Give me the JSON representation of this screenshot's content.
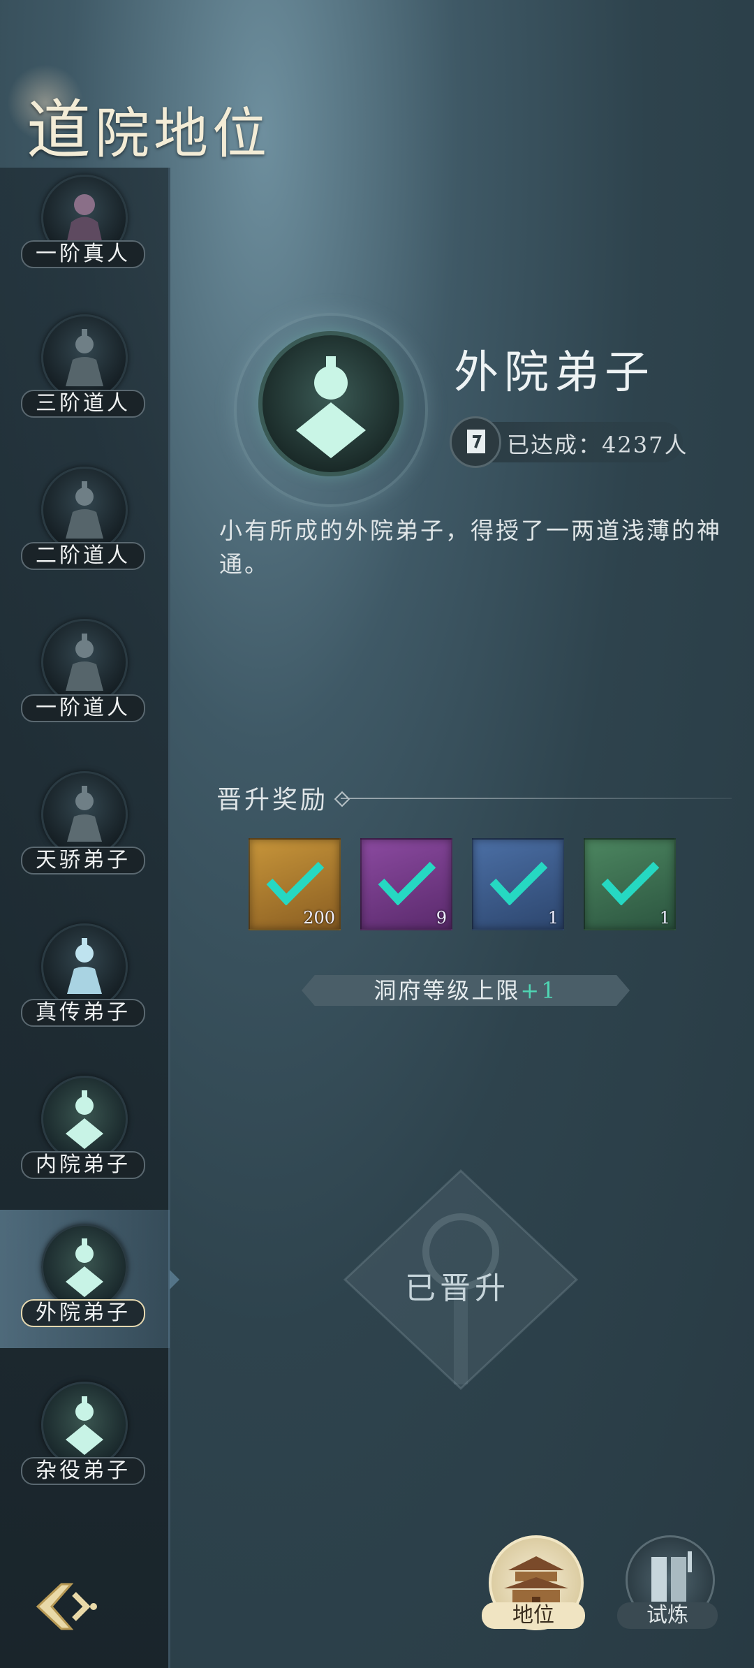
{
  "title": {
    "first_char": "道",
    "rest": "院地位"
  },
  "sidebar": {
    "items": [
      {
        "label": "一阶真人",
        "icon": "true-person-avatar-icon"
      },
      {
        "label": "三阶道人",
        "icon": "daoist-avatar-icon"
      },
      {
        "label": "二阶道人",
        "icon": "daoist-avatar-icon"
      },
      {
        "label": "一阶道人",
        "icon": "daoist-avatar-icon"
      },
      {
        "label": "天骄弟子",
        "icon": "disciple-avatar-icon"
      },
      {
        "label": "真传弟子",
        "icon": "disciple-avatar-icon"
      },
      {
        "label": "内院弟子",
        "icon": "disciple-avatar-icon"
      },
      {
        "label": "外院弟子",
        "icon": "disciple-avatar-icon",
        "selected": true
      },
      {
        "label": "杂役弟子",
        "icon": "disciple-avatar-icon"
      }
    ]
  },
  "detail": {
    "rank_name": "外院弟子",
    "achieved": "已达成：4237人",
    "description": "小有所成的外院弟子，得授了一两道浅薄的神通。"
  },
  "rewards": {
    "title": "晋升奖励",
    "items": [
      {
        "name": "talisman-icon",
        "qty": "200",
        "color": "#b5862f"
      },
      {
        "name": "spirit-stone-icon",
        "qty": "9",
        "color": "#7a3f8f"
      },
      {
        "name": "scroll-icon",
        "qty": "1",
        "color": "#3f5f8f"
      },
      {
        "name": "robe-icon",
        "qty": "1",
        "color": "#3f7050"
      }
    ],
    "bonus_text": "洞府等级上限",
    "bonus_plus": "+1"
  },
  "status": {
    "promoted": "已晋升"
  },
  "bottom_nav": {
    "rank_label": "地位",
    "trial_label": "试炼"
  },
  "colors": {
    "accent": "#4fd6b3",
    "check": "#26d8c2"
  }
}
